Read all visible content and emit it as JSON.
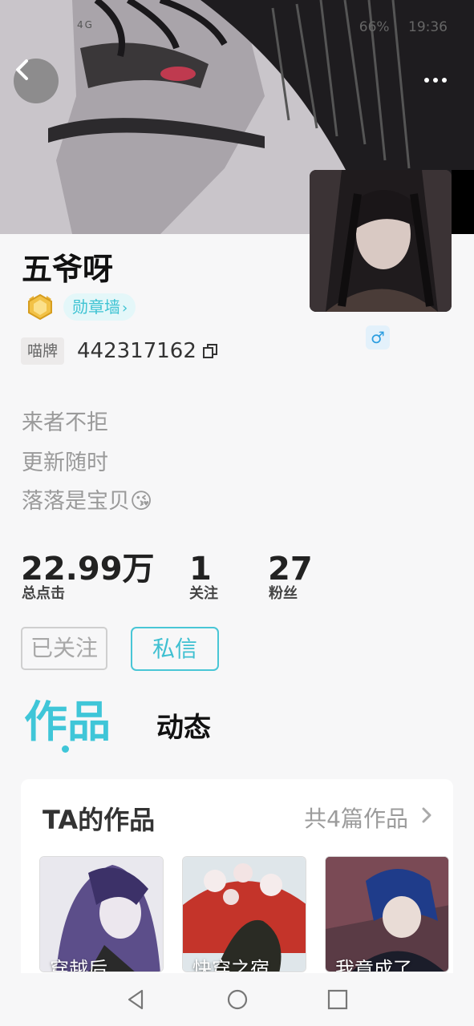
{
  "status_bar": {
    "signal_text": "4G",
    "battery": "66%",
    "time": "19:36"
  },
  "header": {
    "back_icon": "back-arrow-icon",
    "more_icon": "more-dots-icon"
  },
  "profile": {
    "username": "五爷呀",
    "medal_icon": "gold-medal-icon",
    "medal_wall_label": "勋章墙",
    "miaopai_label": "喵牌",
    "user_id": "442317162",
    "copy_icon": "copy-icon",
    "gender_symbol": "♂",
    "bio": [
      "来者不拒",
      "更新随时",
      "落落是宝贝"
    ],
    "bio_emoji": "😘"
  },
  "stats": {
    "total_clicks": {
      "value": "22.99万",
      "label": "总点击"
    },
    "following": {
      "value": "1",
      "label": "关注"
    },
    "fans": {
      "value": "27",
      "label": "粉丝"
    }
  },
  "actions": {
    "follow_label": "已关注",
    "message_label": "私信"
  },
  "tabs": {
    "works": "作品",
    "moments": "动态"
  },
  "works": {
    "title": "TA的作品",
    "count_label": "共4篇作品",
    "covers": [
      {
        "title": "穿越后"
      },
      {
        "title": "快穿之宿"
      },
      {
        "title": "我竟成了"
      }
    ]
  },
  "colors": {
    "accent": "#3fc6d8",
    "background": "#f7f7f8"
  }
}
